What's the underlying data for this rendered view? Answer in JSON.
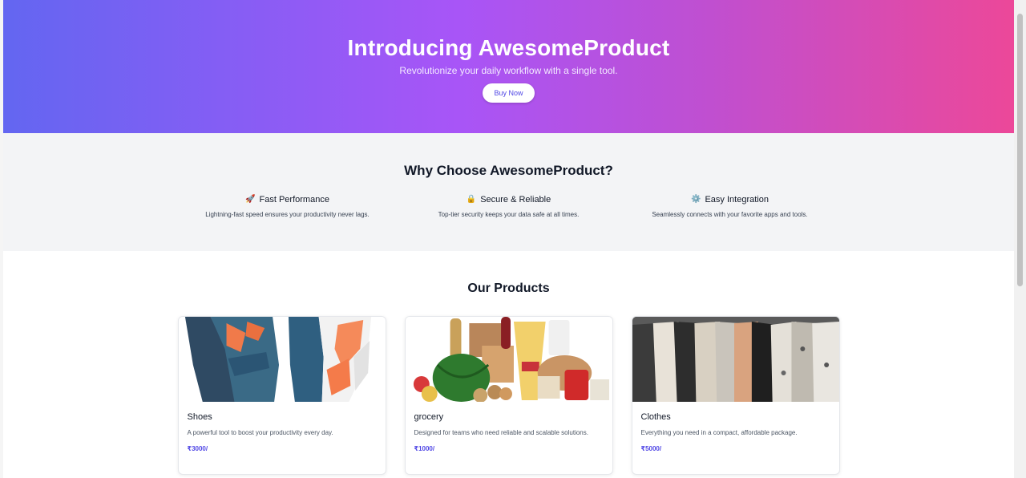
{
  "hero": {
    "title": "Introducing AwesomeProduct",
    "subtitle": "Revolutionize your daily workflow with a single tool.",
    "button_label": "Buy Now"
  },
  "features": {
    "title": "Why Choose AwesomeProduct?",
    "items": [
      {
        "icon": "rocket-icon",
        "glyph": "🚀",
        "title": "Fast Performance",
        "description": "Lightning-fast speed ensures your productivity never lags."
      },
      {
        "icon": "lock-icon",
        "glyph": "🔒",
        "title": "Secure & Reliable",
        "description": "Top-tier security keeps your data safe at all times."
      },
      {
        "icon": "gear-icon",
        "glyph": "⚙️",
        "title": "Easy Integration",
        "description": "Seamlessly connects with your favorite apps and tools."
      }
    ]
  },
  "products": {
    "title": "Our Products",
    "items": [
      {
        "name": "Shoes",
        "description": "A powerful tool to boost your productivity every day.",
        "price": "₹3000/"
      },
      {
        "name": "grocery",
        "description": "Designed for teams who need reliable and scalable solutions.",
        "price": "₹1000/"
      },
      {
        "name": "Clothes",
        "description": "Everything you need in a compact, affordable package.",
        "price": "₹5000/"
      }
    ]
  },
  "colors": {
    "gradient_start": "#6366f1",
    "gradient_mid": "#a855f7",
    "gradient_end": "#ec4899",
    "accent": "#4f46e5",
    "section_bg": "#f3f4f6"
  }
}
